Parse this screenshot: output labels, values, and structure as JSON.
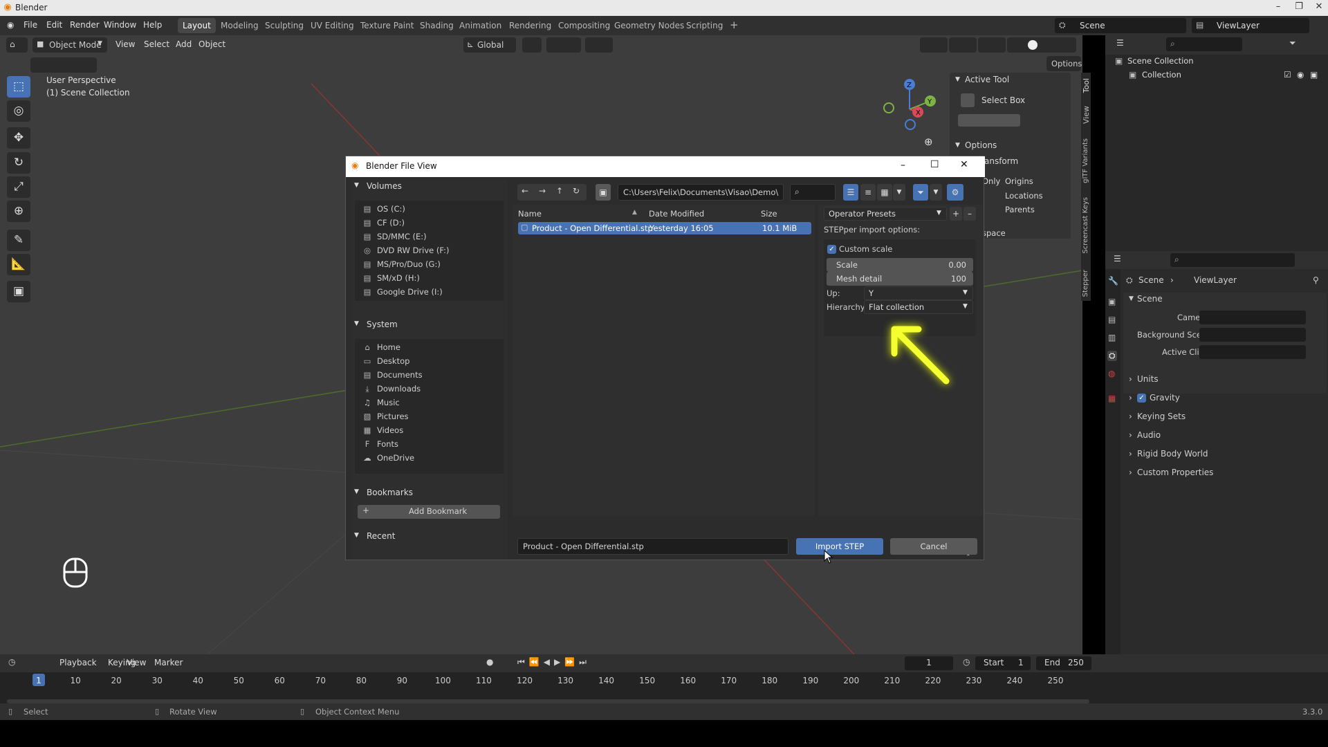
{
  "window": {
    "title": "Blender"
  },
  "menu": [
    "File",
    "Edit",
    "Render",
    "Window",
    "Help"
  ],
  "workspaces": [
    {
      "label": "Layout",
      "active": true
    },
    {
      "label": "Modeling"
    },
    {
      "label": "Sculpting"
    },
    {
      "label": "UV Editing"
    },
    {
      "label": "Texture Paint"
    },
    {
      "label": "Shading"
    },
    {
      "label": "Animation"
    },
    {
      "label": "Rendering"
    },
    {
      "label": "Compositing"
    },
    {
      "label": "Geometry Nodes"
    },
    {
      "label": "Scripting"
    }
  ],
  "scene_field": "Scene",
  "viewlayer_field": "ViewLayer",
  "viewport": {
    "mode": "Object Mode",
    "menus": [
      "View",
      "Select",
      "Add",
      "Object"
    ],
    "orientation": "Global",
    "options_label": "Options",
    "overlay_text_1": "User Perspective",
    "overlay_text_2": "(1) Scene Collection"
  },
  "npanel": {
    "active_tool": "Active Tool",
    "select_box": "Select Box",
    "options": "Options",
    "transform": "ansform",
    "only": "Only",
    "origins": "Origins",
    "locations": "Locations",
    "parents": "Parents",
    "space": "space",
    "tabs": [
      "Tool",
      "View",
      "glTF Variants",
      "Screencast Keys",
      "Stepper"
    ]
  },
  "outliner": {
    "items": [
      "Scene Collection",
      "Collection"
    ]
  },
  "properties": {
    "breadcrumb_scene": "Scene",
    "breadcrumb_viewlayer": "ViewLayer",
    "scene_header": "Scene",
    "camera_label": "Camera",
    "background_label": "Background Scene",
    "clip_label": "Active Clip",
    "sections": [
      "Units",
      "Gravity",
      "Keying Sets",
      "Audio",
      "Rigid Body World",
      "Custom Properties"
    ]
  },
  "dialog": {
    "title": "Blender File View",
    "path": "C:\\Users\\Felix\\Documents\\Visao\\Demo\\",
    "columns": {
      "name": "Name",
      "date": "Date Modified",
      "size": "Size"
    },
    "files": [
      {
        "name": "Product - Open Differential.stp",
        "date": "Yesterday 16:05",
        "size": "10.1 MiB"
      }
    ],
    "filename": "Product - Open Differential.stp",
    "import_label": "Import STEP",
    "cancel_label": "Cancel",
    "volumes_header": "Volumes",
    "volumes": [
      "OS (C:)",
      "CF (D:)",
      "SD/MMC (E:)",
      "DVD RW Drive (F:)",
      "MS/Pro/Duo (G:)",
      "SM/xD (H:)",
      "Google Drive (I:)"
    ],
    "system_header": "System",
    "system": [
      "Home",
      "Desktop",
      "Documents",
      "Downloads",
      "Music",
      "Pictures",
      "Videos",
      "Fonts",
      "OneDrive"
    ],
    "bookmarks_header": "Bookmarks",
    "add_bookmark": "Add Bookmark",
    "recent_header": "Recent",
    "operator_presets": "Operator Presets",
    "import_options": "STEPper import options:",
    "custom_scale": "Custom scale",
    "scale_label": "Scale",
    "scale_value": "0.00",
    "mesh_label": "Mesh detail",
    "mesh_value": "100",
    "up_label": "Up:",
    "up_value": "Y",
    "hierarchy_label": "Hierarchy:",
    "hierarchy_value": "Flat collection"
  },
  "timeline": {
    "menus": [
      "Playback",
      "Keying",
      "View",
      "Marker"
    ],
    "current_frame": "1",
    "start_label": "Start",
    "start_value": "1",
    "end_label": "End",
    "end_value": "250",
    "ticks": [
      "1",
      "10",
      "20",
      "30",
      "40",
      "50",
      "60",
      "70",
      "80",
      "90",
      "100",
      "110",
      "120",
      "130",
      "140",
      "150",
      "160",
      "170",
      "180",
      "190",
      "200",
      "210",
      "220",
      "230",
      "240",
      "250"
    ]
  },
  "status": {
    "select": "Select",
    "rotate": "Rotate View",
    "context": "Object Context Menu",
    "version": "3.3.0"
  },
  "colors": {
    "accent": "#4772b3",
    "highlight_arrow": "#f5ff30"
  }
}
